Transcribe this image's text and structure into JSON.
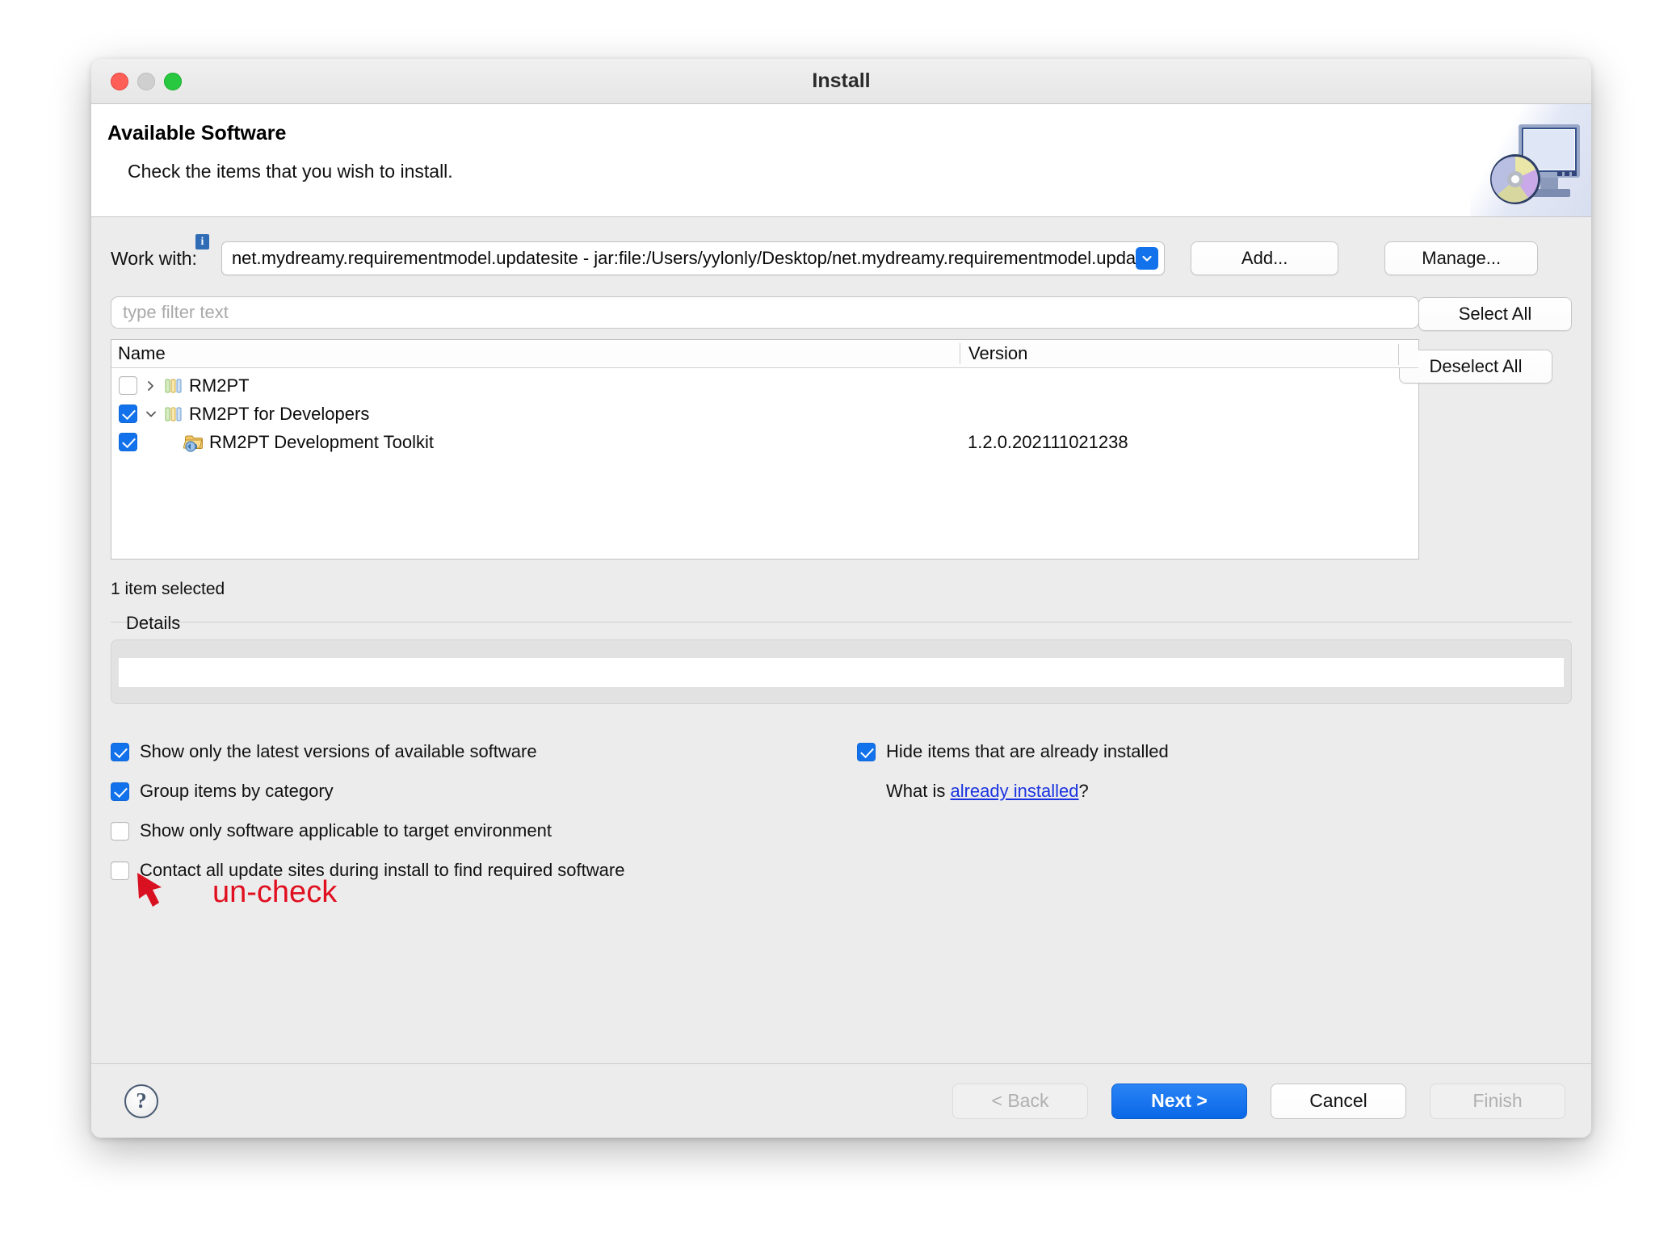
{
  "window": {
    "title": "Install",
    "traffic_lights": [
      "close-button",
      "minimize-button",
      "maximize-button"
    ]
  },
  "banner": {
    "title": "Available Software",
    "subtitle": "Check the items that you wish to install.",
    "artwork": "monitor-cd-icon"
  },
  "work_with": {
    "label": "Work with:",
    "info_badge": "i",
    "value": "net.mydreamy.requirementmodel.updatesite - jar:file:/Users/yylonly/Desktop/net.mydreamy.requirementmodel.upda",
    "dropdown_icon": "chevron-down-icon",
    "add_label": "Add...",
    "manage_label": "Manage..."
  },
  "filter": {
    "placeholder": "type filter text",
    "value": "",
    "select_all_label": "Select All",
    "deselect_all_label": "Deselect All"
  },
  "tree": {
    "columns": [
      "Name",
      "Version"
    ],
    "rows": [
      {
        "name": "RM2PT",
        "version": "",
        "checked": false,
        "expanded": false,
        "level": 0,
        "icon": "category-icon"
      },
      {
        "name": "RM2PT for Developers",
        "version": "",
        "checked": true,
        "expanded": true,
        "level": 0,
        "icon": "category-icon"
      },
      {
        "name": "RM2PT Development Toolkit",
        "version": "1.2.0.202111021238",
        "checked": true,
        "expanded": null,
        "level": 1,
        "icon": "feature-plugin-icon"
      }
    ],
    "selection_status": "1 item selected"
  },
  "details": {
    "legend": "Details",
    "text": ""
  },
  "options": {
    "left": [
      {
        "label": "Show only the latest versions of available software",
        "checked": true
      },
      {
        "label": "Group items by category",
        "checked": true
      },
      {
        "label": "Show only software applicable to target environment",
        "checked": false
      },
      {
        "label": "Contact all update sites during install to find required software",
        "checked": false
      }
    ],
    "right": [
      {
        "label": "Hide items that are already installed",
        "checked": true
      }
    ],
    "what_is_prefix": "What is ",
    "what_is_link": "already installed",
    "what_is_suffix": "?"
  },
  "annotation": {
    "text": "un-check",
    "color": "#e01020",
    "arrow": "arrow-up-left-icon"
  },
  "footer": {
    "help_label": "?",
    "back_label": "< Back",
    "next_label": "Next >",
    "cancel_label": "Cancel",
    "finish_label": "Finish"
  },
  "colors": {
    "accent": "#1272ec",
    "link": "#1a33e0",
    "annotation": "#e01020"
  }
}
